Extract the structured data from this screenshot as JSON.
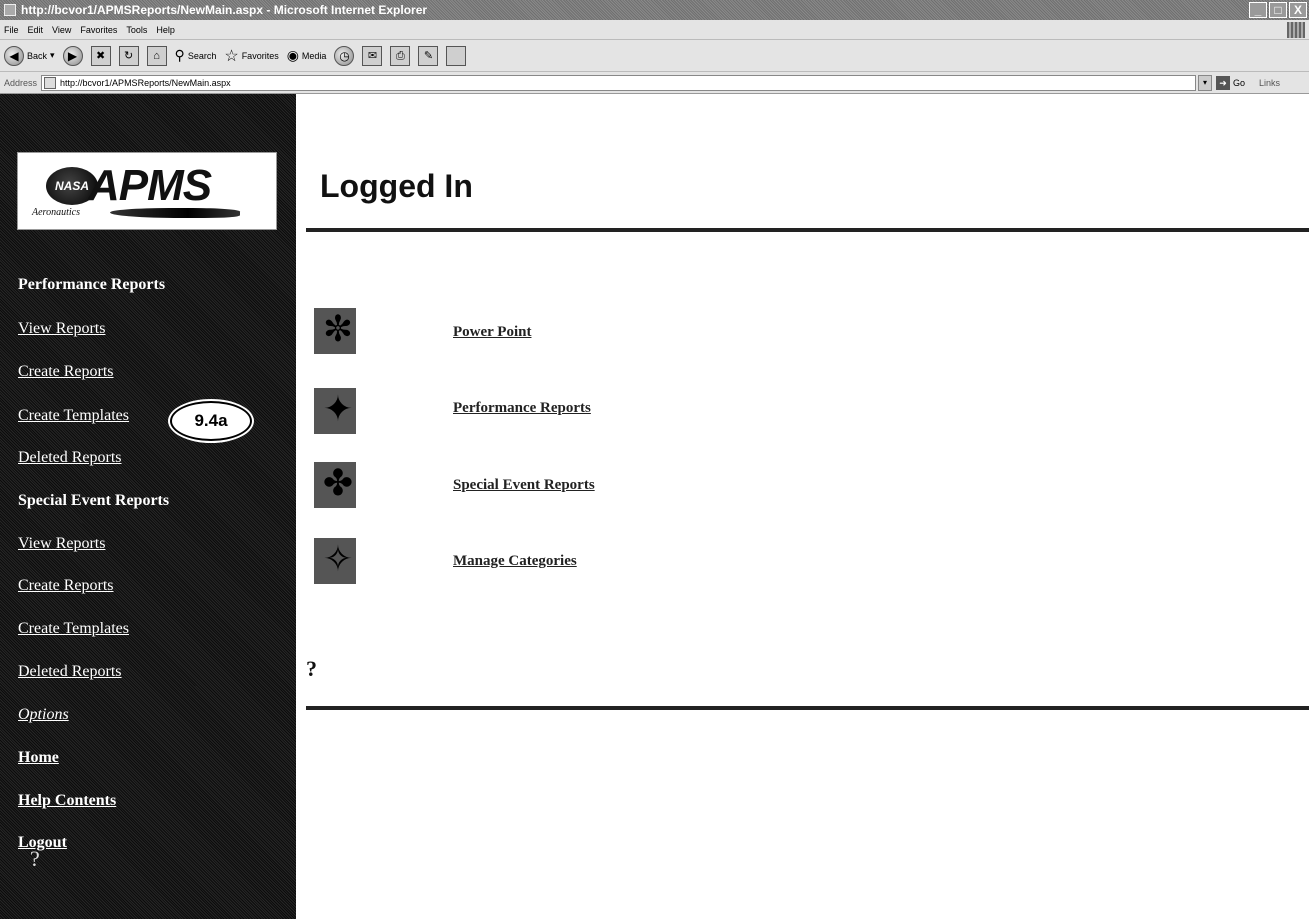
{
  "window": {
    "title": "http://bcvor1/APMSReports/NewMain.aspx - Microsoft Internet Explorer",
    "buttons": [
      "_",
      "□",
      "X"
    ]
  },
  "menu": [
    "File",
    "Edit",
    "View",
    "Favorites",
    "Tools",
    "Help"
  ],
  "toolbar": {
    "back": "Back",
    "search": "Search",
    "favorites": "Favorites",
    "media": "Media"
  },
  "address": {
    "label": "Address",
    "url": "http://bcvor1/APMSReports/NewMain.aspx",
    "go": "Go",
    "links": "Links"
  },
  "logo": {
    "nasa": "NASA",
    "text": "APMS",
    "script": "Aeronautics"
  },
  "sidebar": {
    "performance_heading": "Performance Reports",
    "perf_view": "View Reports",
    "perf_create": "Create Reports",
    "perf_templates": "Create Templates",
    "perf_deleted": "Deleted Reports",
    "special_heading": "Special Event Reports",
    "sp_view": "View Reports",
    "sp_create": "Create Reports",
    "sp_templates": "Create Templates",
    "sp_deleted": "Deleted Reports",
    "options": "Options",
    "home": "Home",
    "help": "Help Contents",
    "logout": "Logout",
    "help_mark": "?"
  },
  "callout": "9.4a",
  "main": {
    "title": "Logged In",
    "actions": [
      "Power Point",
      "Performance Reports",
      "Special Event Reports",
      "Manage Categories"
    ],
    "help_mark": "?"
  }
}
